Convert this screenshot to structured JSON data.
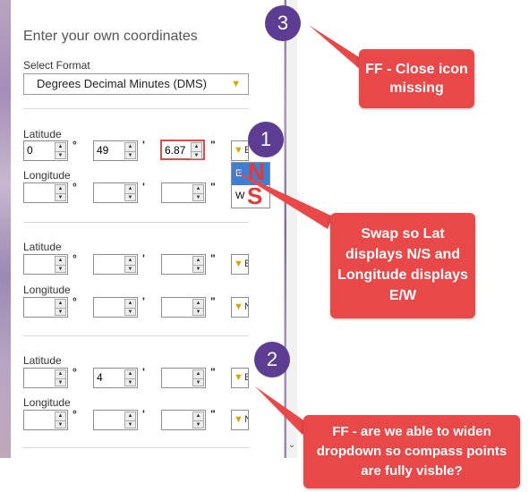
{
  "panel": {
    "title": "Enter your own coordinates",
    "format_label": "Select Format",
    "format_value": "Degrees Decimal Minutes (DMS)",
    "degree_symbol": "°",
    "minute_symbol": "'",
    "second_symbol": "\"",
    "groups": [
      {
        "lat_label": "Latitude",
        "lat": {
          "deg": "0",
          "min": "49",
          "sec": "6.87",
          "dir": "E"
        },
        "lon_label": "Longitude",
        "lon": {
          "deg": "",
          "min": "",
          "sec": "",
          "dir": ""
        },
        "dropdown_options": [
          "E",
          "W"
        ]
      },
      {
        "lat_label": "Latitude",
        "lat": {
          "deg": "",
          "min": "",
          "sec": "",
          "dir": "E"
        },
        "lon_label": "Longitude",
        "lon": {
          "deg": "",
          "min": "",
          "sec": "",
          "dir": "N"
        }
      },
      {
        "lat_label": "Latitude",
        "lat": {
          "deg": "",
          "min": "4",
          "sec": "",
          "dir": "E"
        },
        "lon_label": "Longitude",
        "lon": {
          "deg": "",
          "min": "",
          "sec": "",
          "dir": "N"
        }
      }
    ]
  },
  "annotations": {
    "overlay_n": "N",
    "overlay_s": "S",
    "badge_1": "1",
    "badge_2": "2",
    "badge_3": "3",
    "callout_close": "FF - Close icon missing",
    "callout_swap": "Swap so Lat displays N/S and Longitude displays E/W",
    "callout_widen": "FF - are we able to widen dropdown so compass points are fully visble?"
  },
  "colors": {
    "callout": "#e84848",
    "badge": "#5c3d91",
    "caret": "#d4a500",
    "highlight": "#e44a4a",
    "selected_option": "#3f7ed3"
  }
}
